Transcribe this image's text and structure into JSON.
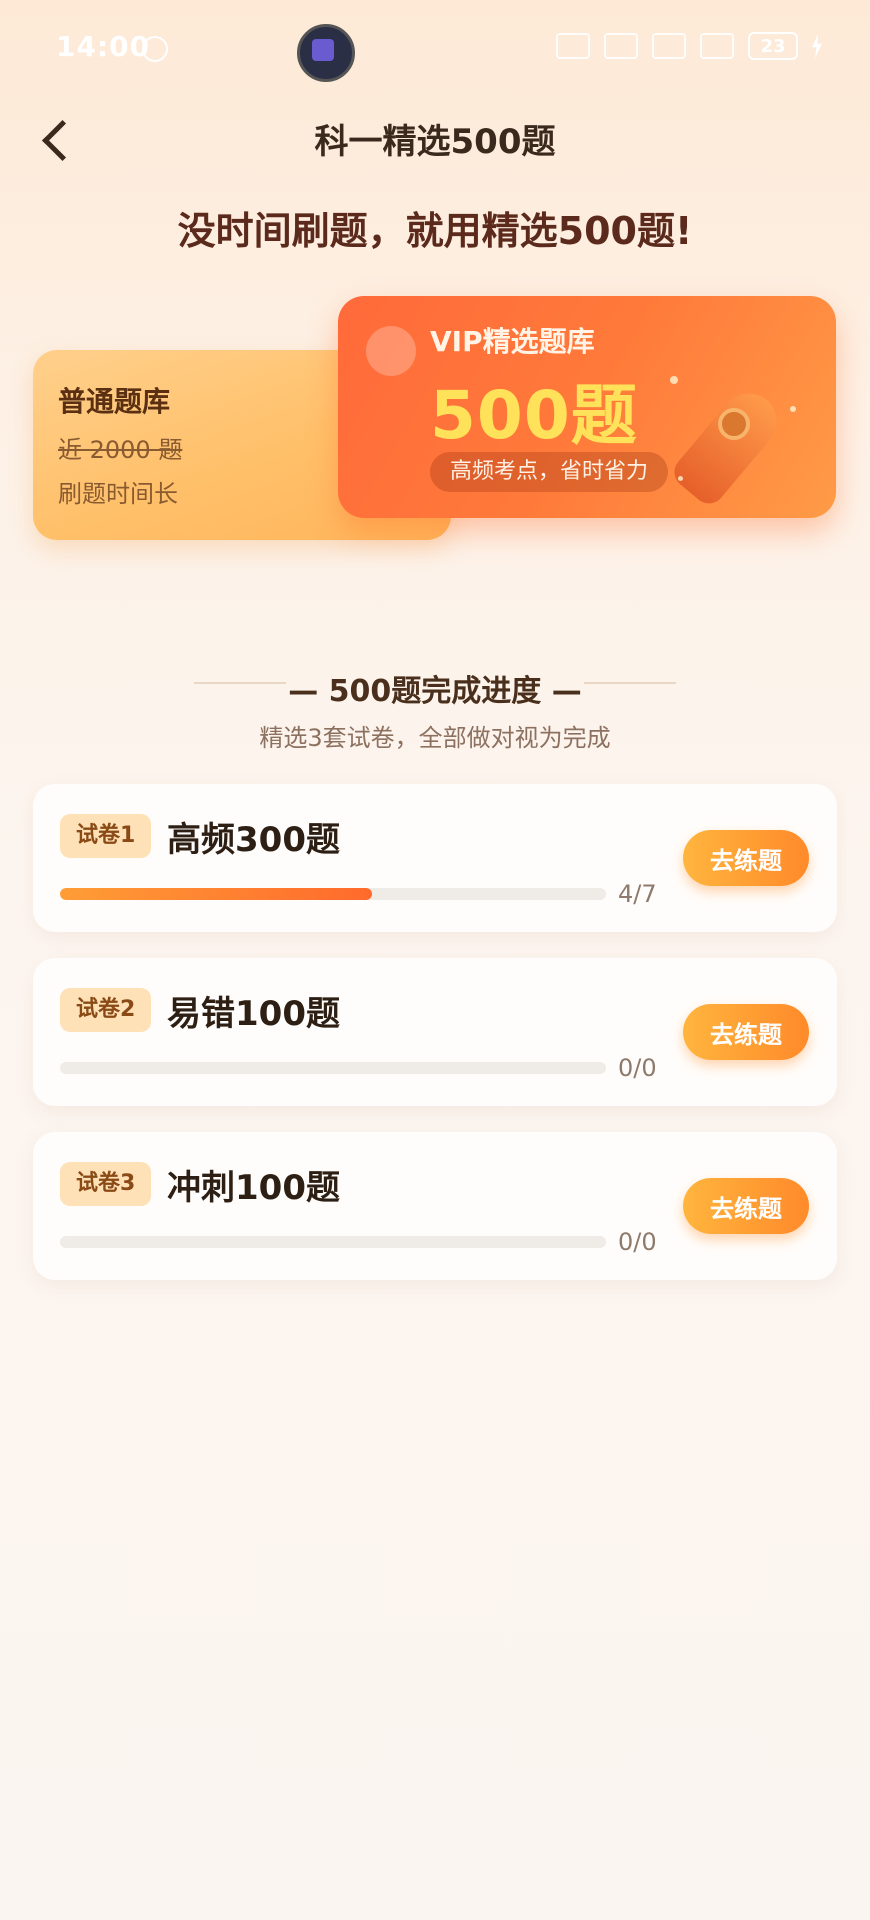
{
  "status_bar": {
    "time": "14:00",
    "battery": "23",
    "icons": [
      "alarm-icon",
      "headphones-icon",
      "wifi-icon",
      "signal-5g-icon",
      "signal-icon",
      "battery-icon",
      "charging-icon"
    ]
  },
  "header": {
    "title": "科一精选500题",
    "back_icon": "chevron-left-icon"
  },
  "slogan": "没时间刷题，就用精选500题!",
  "normal_bank": {
    "title": "普通题库",
    "count": "近 2000 题",
    "desc": "刷题时间长"
  },
  "vip_bank": {
    "title": "VIP精选题库",
    "count": "500题",
    "tag": "高频考点，省时省力",
    "icon": "rocket-icon"
  },
  "progress_section": {
    "title": "— 500题完成进度 —",
    "subtitle": "精选3套试卷，全部做对视为完成"
  },
  "papers": [
    {
      "badge": "试卷1",
      "title": "高频300题",
      "count": "4/7",
      "progress": 0.5714,
      "button": "去练题"
    },
    {
      "badge": "试卷2",
      "title": "易错100题",
      "count": "0/0",
      "progress": 0,
      "button": "去练题"
    },
    {
      "badge": "试卷3",
      "title": "冲刺100题",
      "count": "0/0",
      "progress": 0,
      "button": "去练题"
    }
  ],
  "colors": {
    "accent": "#ff7a3a",
    "vip_count": "#ffe25a",
    "progress_fill": "#ff7f30",
    "button": "#ff9a32"
  }
}
